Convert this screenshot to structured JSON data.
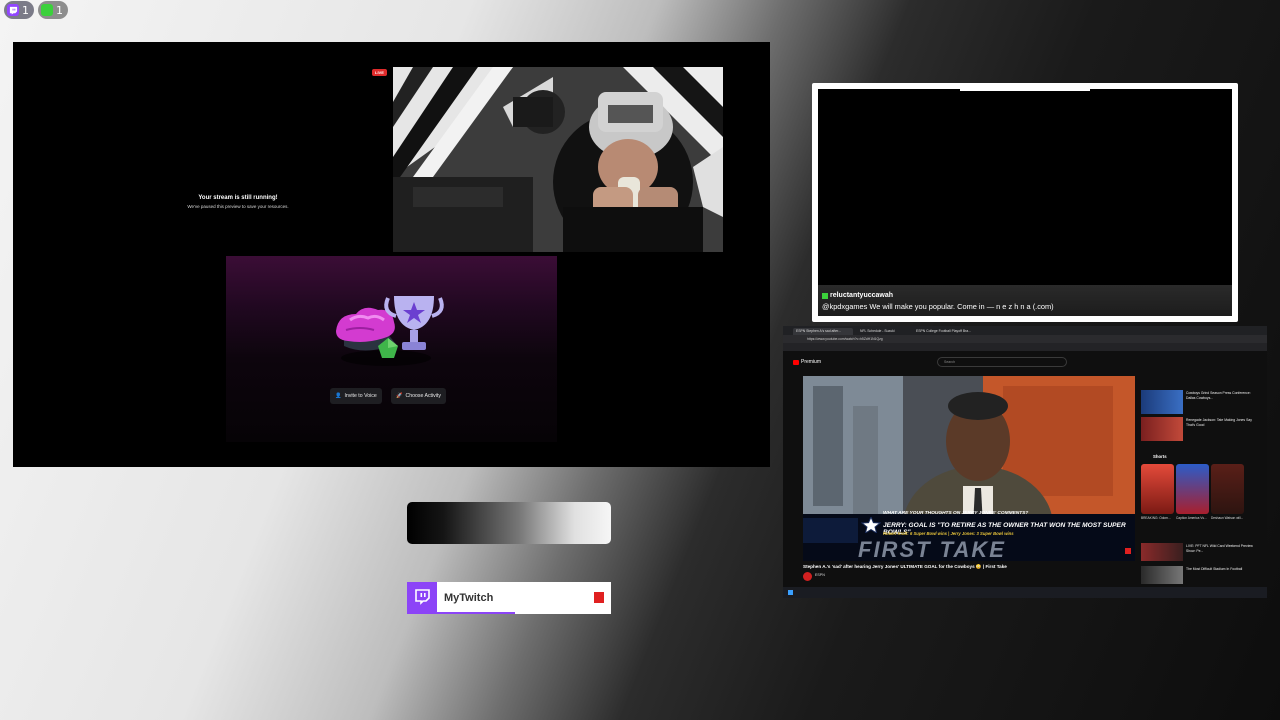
{
  "badges": [
    {
      "icon": "twitch-icon",
      "count": "1",
      "color": "#9146ff"
    },
    {
      "icon": "camera-icon",
      "count": "1",
      "color": "#3bd13b"
    }
  ],
  "discord": {
    "paused_title": "Your stream is still running!",
    "paused_subtitle": "We've paused this preview to save your resources.",
    "live_label": "LIVE",
    "invite_button": "Invite to Voice",
    "activity_button": "Choose Activity"
  },
  "chat": {
    "username": "reluctantyuccawah",
    "message": "@kpdxgames We will make you popular. Come in — n e z h n a (.com)"
  },
  "browser": {
    "tabs": [
      "ESPN Stephen A's sad after...",
      "NFL Schedule - Suzuki",
      "ESPN College Football Playoff Bra..."
    ],
    "url": "https://www.youtube.com/watch?v=h5ZdH1N1Qzg",
    "yt_brand": "Premium",
    "search_placeholder": "Search",
    "video_question": "WHAT ARE YOUR THOUGHTS ON JERRY JONES' COMMENTS?",
    "video_headline": "JERRY: GOAL IS \"TO RETIRE AS THE OWNER THAT WON THE MOST SUPER BOWLS\"",
    "video_subline": "Robert Kraft: 6 Super Bowl wins | Jerry Jones: 3 Super Bowl wins",
    "show_logo": "FIRST TAKE",
    "video_title": "Stephen A.'s 'sad' after hearing Jerry Jones' ULTIMATE GOAL for the Cowboys 😳 | First Take",
    "channel": "ESPN",
    "sidebar": [
      "Cowboys Grind Season Press Conference: Dallas Cowboys...",
      "Renegade Jackson: Tate Making Jones Say That's Good"
    ],
    "shorts_label": "Shorts",
    "shorts": [
      "BREAKING: Odom...",
      "Caption America Vs...",
      "Deshaun Watson will..."
    ],
    "sidebar_bottom": [
      "LIVE: PFT NFL Wild Card Weekend Preview Show: Pe...",
      "The Most Difficult Stadium In Football"
    ]
  },
  "overlay": {
    "brand": "MyTwitch"
  },
  "colors": {
    "twitch_purple": "#8c44f7",
    "live_red": "#e02b2b",
    "youtube_red": "#ff0000"
  }
}
